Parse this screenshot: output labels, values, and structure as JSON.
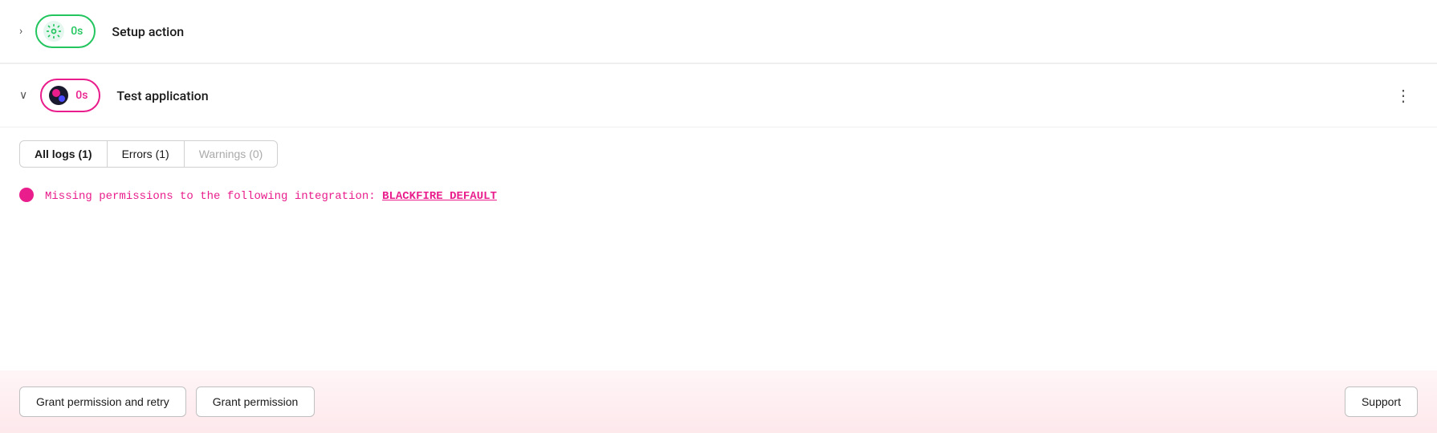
{
  "setup_action": {
    "chevron": "›",
    "badge_time": "0s",
    "label": "Setup action"
  },
  "test_application": {
    "chevron": "∨",
    "badge_time": "0s",
    "label": "Test application",
    "more_icon": "⋮"
  },
  "tabs": {
    "all_logs": "All logs (1)",
    "errors": "Errors (1)",
    "warnings": "Warnings (0)"
  },
  "error": {
    "message": "Missing permissions to the following integration: ",
    "integration": "BLACKFIRE_DEFAULT"
  },
  "footer": {
    "grant_permission_retry": "Grant permission and retry",
    "grant_permission": "Grant permission",
    "support": "Support"
  }
}
